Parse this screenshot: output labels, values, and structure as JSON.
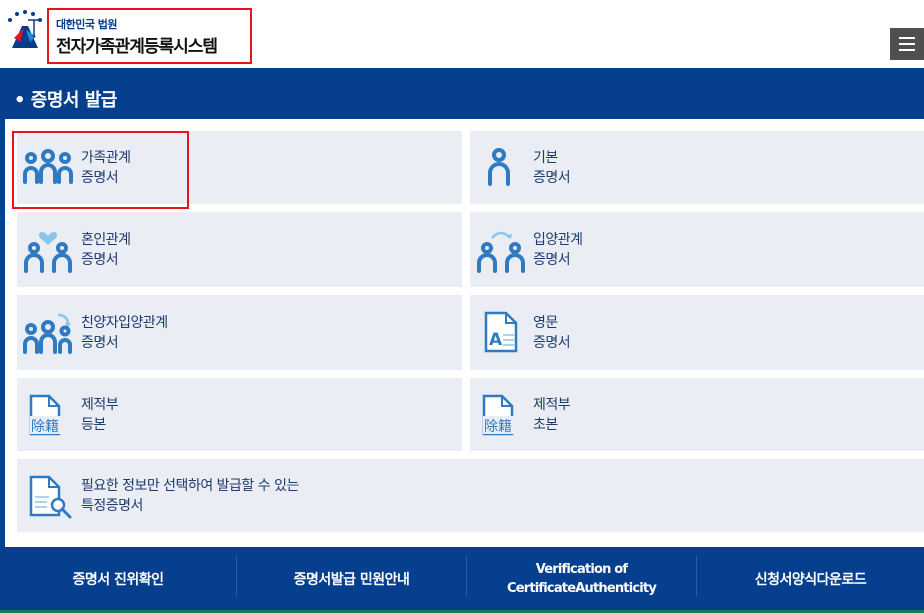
{
  "header": {
    "org_name": "대한민국 법원",
    "system_name": "전자가족관계등록시스템"
  },
  "section": {
    "title": "• 증명서 발급"
  },
  "cards": [
    {
      "line1": "가족관계",
      "line2": "증명서",
      "icon": "family-icon"
    },
    {
      "line1": "기본",
      "line2": "증명서",
      "icon": "person-icon"
    },
    {
      "line1": "혼인관계",
      "line2": "증명서",
      "icon": "marriage-icon"
    },
    {
      "line1": "입양관계",
      "line2": "증명서",
      "icon": "adoption-icon"
    },
    {
      "line1": "친양자입양관계",
      "line2": "증명서",
      "icon": "full-adoption-icon"
    },
    {
      "line1": "영문",
      "line2": "증명서",
      "icon": "english-document-icon"
    },
    {
      "line1": "제적부",
      "line2": "등본",
      "icon": "removed-register-icon",
      "tag": "除籍"
    },
    {
      "line1": "제적부",
      "line2": "초본",
      "icon": "removed-register-icon",
      "tag": "除籍"
    },
    {
      "line1": "필요한 정보만 선택하여 발급할 수 있는",
      "line2": "특정증명서",
      "icon": "document-search-icon"
    }
  ],
  "english_icon_letter": "A",
  "footer": {
    "links": [
      {
        "label": "증명서 진위확인"
      },
      {
        "label": "증명서발급 민원안내"
      },
      {
        "line1": "Verification of",
        "line2": "CertificateAuthenticity"
      },
      {
        "label": "신청서양식다운로드"
      }
    ]
  },
  "colors": {
    "primary_blue": "#063f8e",
    "card_bg": "#eaeef4",
    "icon_blue": "#2f7ac0",
    "highlight_red": "#e8141c"
  }
}
